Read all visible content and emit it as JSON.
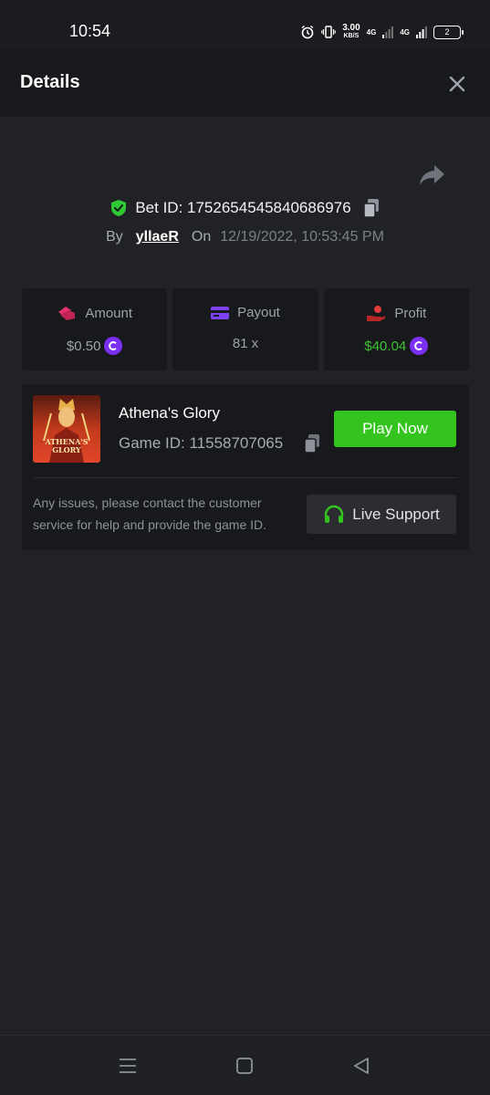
{
  "status_bar": {
    "time": "10:54",
    "net_speed_value": "3.00",
    "net_speed_unit": "KB/S",
    "network_1": "4G",
    "network_2": "4G",
    "battery": "2"
  },
  "header": {
    "title": "Details",
    "close_icon": "close-icon"
  },
  "bet": {
    "id_label": "Bet ID: 1752654545840686976",
    "by_label": "By",
    "username": "yllaeR",
    "on_label": "On",
    "datetime": "12/19/2022, 10:53:45 PM"
  },
  "stats": [
    {
      "label": "Amount",
      "value": "$0.50",
      "icon": "amount-icon",
      "color": "#e6326e"
    },
    {
      "label": "Payout",
      "value": "81 x",
      "icon": "payout-card-icon",
      "color": "#7b42f6"
    },
    {
      "label": "Profit",
      "value": "$40.04",
      "icon": "profit-hand-icon",
      "color": "#e23b3b"
    }
  ],
  "game": {
    "name": "Athena's Glory",
    "id_label": "Game ID: 11558707065",
    "thumb_text_line1": "ATHENA'S",
    "thumb_text_line2": "GLORY",
    "play_label": "Play Now",
    "help_text": "Any issues, please contact the customer service for help and provide the game ID.",
    "support_label": "Live Support"
  },
  "colors": {
    "accent_green": "#33c41d",
    "profit_green": "#3ec235",
    "coin_purple": "#7b2ff2",
    "background": "#212226",
    "card": "#18191c"
  }
}
